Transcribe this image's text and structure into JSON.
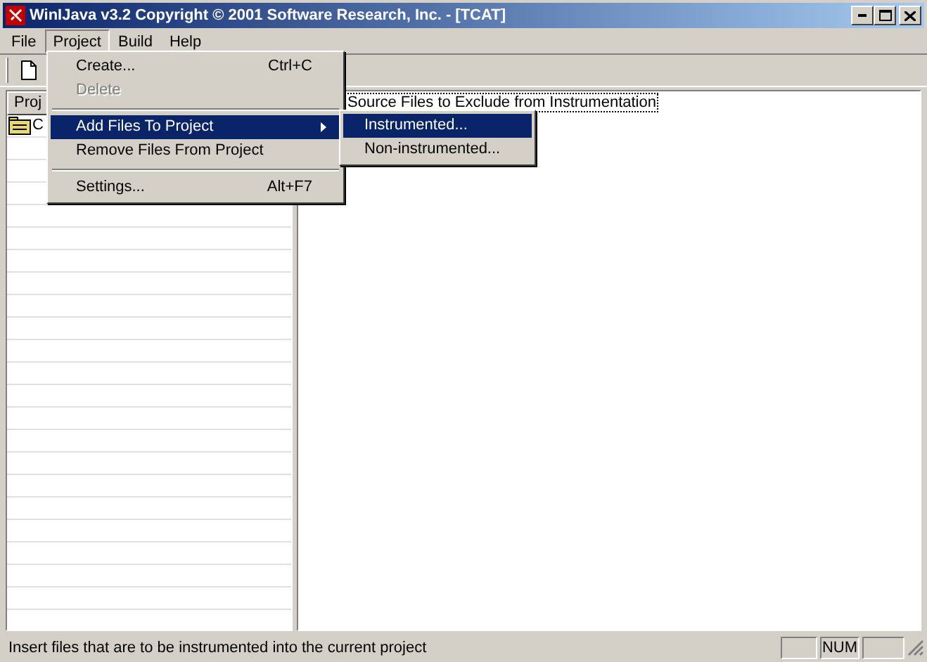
{
  "window": {
    "title": "WinIJava v3.2 Copyright © 2001 Software Research, Inc. - [TCAT]"
  },
  "menubar": [
    {
      "label": "File",
      "selected": false
    },
    {
      "label": "Project",
      "selected": true
    },
    {
      "label": "Build",
      "selected": false
    },
    {
      "label": "Help",
      "selected": false
    }
  ],
  "left_pane": {
    "header": "Proj",
    "items": [
      {
        "label": "C"
      }
    ]
  },
  "right_pane": {
    "items": [
      {
        "label": "Source Files to Exclude from Instrumentation"
      }
    ]
  },
  "menu": [
    {
      "kind": "item",
      "label": "Create...",
      "shortcut": "Ctrl+C",
      "disabled": false,
      "selected": false
    },
    {
      "kind": "item",
      "label": "Delete",
      "disabled": true,
      "selected": false
    },
    {
      "kind": "separator"
    },
    {
      "kind": "submenu",
      "label": "Add Files To Project",
      "disabled": false,
      "selected": true
    },
    {
      "kind": "item",
      "label": "Remove Files From Project",
      "disabled": false,
      "selected": false
    },
    {
      "kind": "separator"
    },
    {
      "kind": "item",
      "label": "Settings...",
      "shortcut": "Alt+F7",
      "disabled": false,
      "selected": false
    }
  ],
  "submenu": [
    {
      "label": "Instrumented...",
      "selected": true
    },
    {
      "label": "Non-instrumented...",
      "selected": false
    }
  ],
  "status_bar": {
    "message": "Insert files that are to be instrumented into the current project",
    "num_lock": "NUM"
  }
}
